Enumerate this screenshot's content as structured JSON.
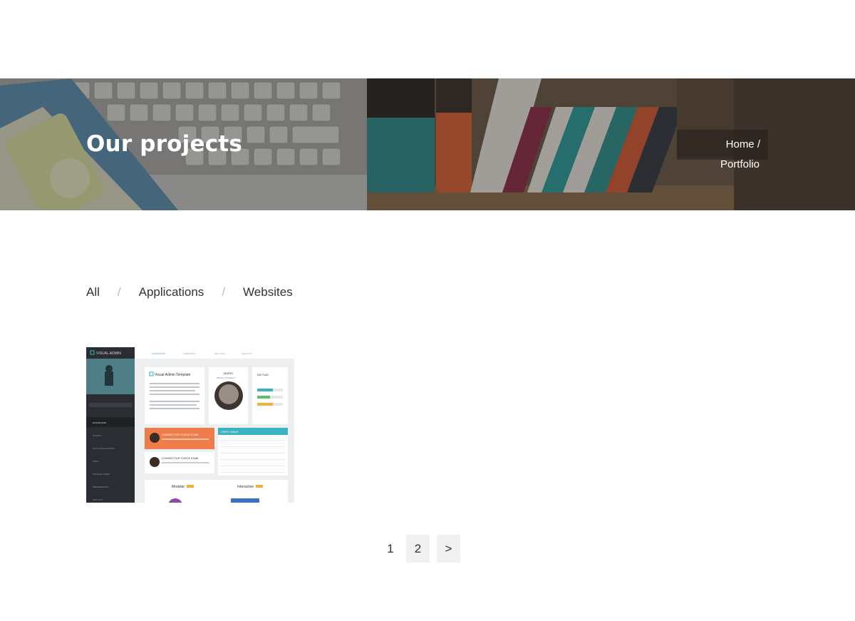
{
  "hero": {
    "title": "Our projects",
    "breadcrumb": {
      "home_label": "Home",
      "separator": "/",
      "current_label": "Portfolio"
    }
  },
  "filters": {
    "items": [
      "All",
      "Applications",
      "Websites"
    ],
    "separator": "/"
  },
  "portfolio": {
    "items": [
      {
        "thumbnail": {
          "brand": "VISUAL ADMIN",
          "nav_tabs": [
            "DASHBOARD",
            "TEMPLATES",
            "SETTINGS",
            "SIGN OUT"
          ],
          "card_title": "Visual Admin Template",
          "project_label": "MARIS",
          "project_sub": "DESIGN PROJECT",
          "skills_title": "DICTUM",
          "promo_title": "CONSECTUR FUSCE ENIM",
          "table_title": "USER TABLE",
          "chart_labels": [
            "Modular",
            "Interactive"
          ],
          "sidebar": [
            "DASHBOARD",
            "CHARTS",
            "DATA VISUALIZATION",
            "MAPS",
            "MANAGE USERS",
            "PREFERENCES",
            "SIGN OUT"
          ]
        }
      }
    ]
  },
  "pagination": {
    "pages": [
      "1",
      "2"
    ],
    "next_label": ">",
    "current": "1"
  },
  "colors": {
    "accent_teal": "#39b3c0",
    "accent_orange": "#ef7c4b",
    "sidebar_dark": "#2a2d31"
  }
}
